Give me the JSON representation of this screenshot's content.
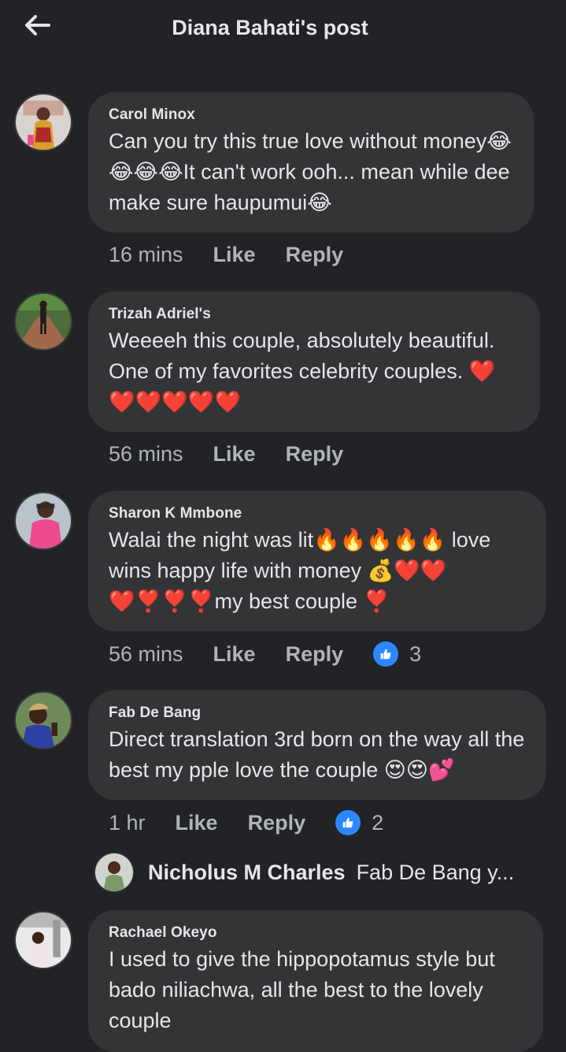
{
  "header": {
    "title": "Diana  Bahati's post"
  },
  "comments": [
    {
      "name": "Carol Minox",
      "text": "Can you try this true love without money😂😂😂😂It can't work ooh... mean while dee make sure haupumui😂",
      "time": "16 mins",
      "like": "Like",
      "reply": "Reply",
      "reactions": ""
    },
    {
      "name": "Trizah Adriel's",
      "text": "Weeeeh this couple, absolutely beautiful. One of my favorites celebrity couples. ❤️❤️❤️❤️❤️❤️",
      "time": "56 mins",
      "like": "Like",
      "reply": "Reply",
      "reactions": ""
    },
    {
      "name": "Sharon K Mmbone",
      "text": "Walai the night was lit🔥🔥🔥🔥🔥 love wins happy life with money 💰❤️❤️❤️❣️❣️❣️my best couple ❣️",
      "time": "56 mins",
      "like": "Like",
      "reply": "Reply",
      "reactions": "3"
    },
    {
      "name": "Fab De Bang",
      "text": "Direct translation 3rd born on the way all the best my pple love the couple 😍😍💕",
      "time": "1 hr",
      "like": "Like",
      "reply": "Reply",
      "reactions": "2"
    },
    {
      "name": "Rachael Okeyo",
      "text": "I used to give the hippopotamus style but bado niliachwa, all the best to the lovely couple"
    }
  ],
  "reply_preview": {
    "name": "Nicholus M Charles",
    "snippet": "Fab De Bang y..."
  },
  "icons": {
    "back": "arrow-left-icon",
    "like_badge": "thumbs-up-icon"
  },
  "colors": {
    "background": "#222326",
    "bubble": "#333436",
    "meta": "#b0b3b8",
    "accent": "#2d88ff"
  }
}
